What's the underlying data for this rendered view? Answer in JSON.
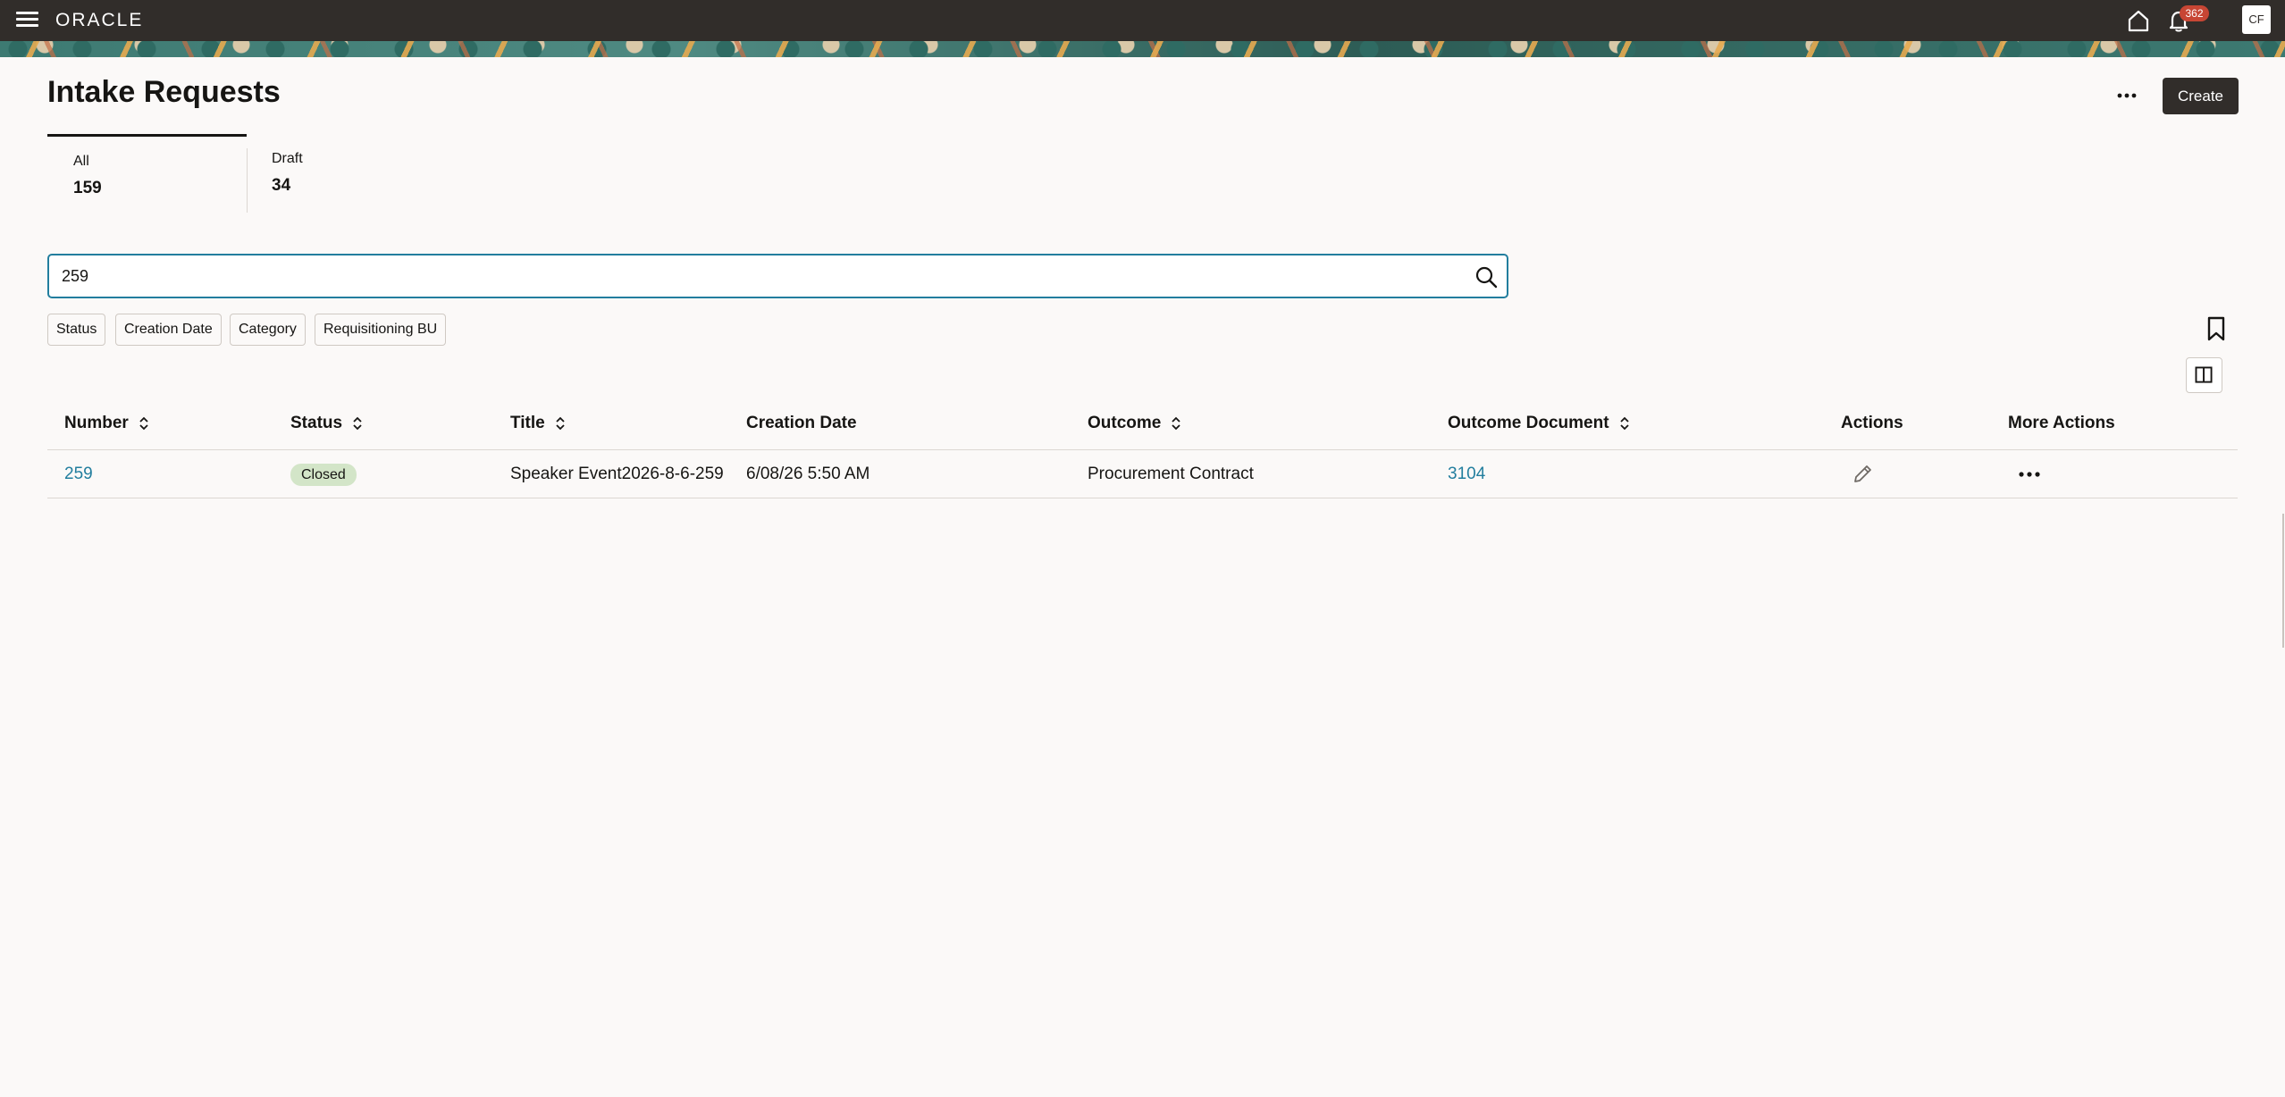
{
  "topbar": {
    "logo": "ORACLE",
    "notifications_count": "362",
    "avatar_initials": "CF"
  },
  "page": {
    "title": "Intake Requests",
    "create_label": "Create"
  },
  "tabs": [
    {
      "label": "All",
      "count": "159"
    },
    {
      "label": "Draft",
      "count": "34"
    }
  ],
  "search": {
    "value": "259",
    "placeholder": ""
  },
  "filters": [
    "Status",
    "Creation Date",
    "Category",
    "Requisitioning BU"
  ],
  "table": {
    "columns": [
      "Number",
      "Status",
      "Title",
      "Creation Date",
      "Outcome",
      "Outcome Document",
      "Actions",
      "More Actions"
    ],
    "rows": [
      {
        "number": "259",
        "status": "Closed",
        "title": "Speaker Event2026-8-6-259",
        "creation_date": "6/08/26 5:50 AM",
        "outcome": "Procurement Contract",
        "outcome_document": "3104"
      }
    ]
  },
  "colors": {
    "topbar": "#312d2a",
    "link": "#227e9e",
    "badge_closed": "#d3e5c8",
    "notification_badge": "#c74634"
  }
}
